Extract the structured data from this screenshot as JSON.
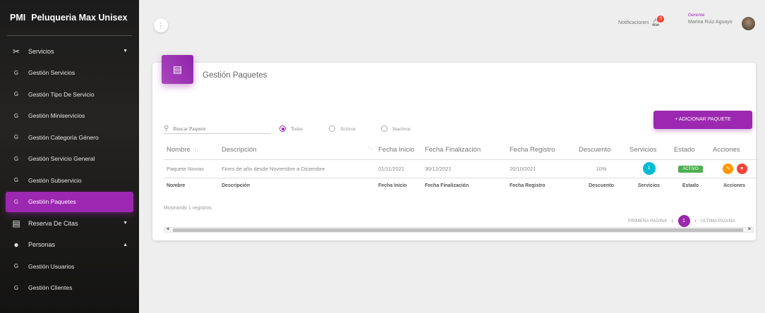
{
  "brand": {
    "abbr": "PMI",
    "name": "Peluqueria Max Unisex"
  },
  "sidebar": {
    "items": [
      {
        "icon": "✂",
        "label": "Servicios",
        "group": true
      },
      {
        "icon": "G",
        "label": "Gestión Servicios"
      },
      {
        "icon": "G",
        "label": "Gestión Tipo De Servicio"
      },
      {
        "icon": "G",
        "label": "Gestión Miniservicios"
      },
      {
        "icon": "G",
        "label": "Gestión Categoría Género"
      },
      {
        "icon": "G",
        "label": "Gestión Servicio General"
      },
      {
        "icon": "G",
        "label": "Gestión Subservicio"
      },
      {
        "icon": "G",
        "label": "Gestión Paquetes",
        "active": true
      },
      {
        "icon": "▤",
        "label": "Reserva De Citas",
        "group": true
      },
      {
        "icon": "●",
        "label": "Personas",
        "group": true
      },
      {
        "icon": "G",
        "label": "Gestión Usuarios"
      },
      {
        "icon": "G",
        "label": "Gestión Clientes"
      }
    ]
  },
  "topbar": {
    "menu_icon": "⋮",
    "notifications_label": "Notificaciones",
    "notifications_count": "0",
    "user_role": "Gerente",
    "user_name": "Marina Ruiz Aguayo"
  },
  "card": {
    "title": "Gestión Paquetes",
    "add_button": "+ ADICIONAR PAQUETE",
    "search_placeholder": "Buscar Paquete",
    "filters": [
      "Todos",
      "Activos",
      "Inactivos"
    ],
    "selected_filter": "Todos"
  },
  "table": {
    "headers": [
      "Nombre",
      "Descripción",
      "Fecha Inicio",
      "Fecha Finalización",
      "Fecha Registro",
      "Descuento",
      "Servicios",
      "Estado",
      "Acciones"
    ],
    "rows": [
      {
        "nombre": "Paquete Novias",
        "descripcion": "Fines de año desde Noviembre a Diciembre",
        "fecha_inicio": "01/11/2021",
        "fecha_fin": "30/12/2021",
        "fecha_registro": "20/10/2021",
        "descuento": "10%",
        "servicios": "1",
        "estado": "ACTIVO"
      }
    ]
  },
  "footer": {
    "showing": "Mostrando 1 registros",
    "first_page": "PRIMERA PAGINA",
    "page": "1",
    "last_page": "ULTIMA PAGINA"
  },
  "colors": {
    "accent": "#9c27b0",
    "active_status": "#4caf50",
    "service_badge": "#00bcd4",
    "edit": "#ff9800",
    "delete": "#f44336"
  }
}
